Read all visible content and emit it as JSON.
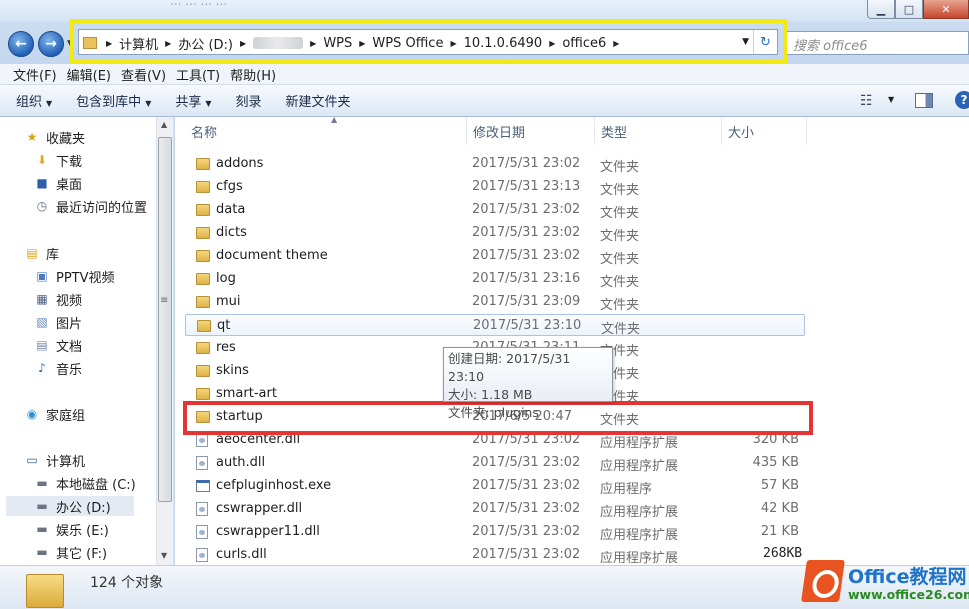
{
  "window": {
    "faded_title": "... ... ... ...",
    "minimize_glyph": "▁",
    "maximize_glyph": "□",
    "close_glyph": "✕"
  },
  "nav": {
    "back_glyph": "←",
    "forward_glyph": "→",
    "dropdown_glyph": "▼"
  },
  "address": {
    "crumbs": [
      "计算机",
      "办公 (D:)",
      "",
      "WPS",
      "WPS Office",
      "10.1.0.6490",
      "office6"
    ],
    "separator": "▶",
    "dropdown_glyph": "▼",
    "refresh_glyph": "↻"
  },
  "search": {
    "placeholder": "搜索 office6"
  },
  "menubar": [
    "文件(F)",
    "编辑(E)",
    "查看(V)",
    "工具(T)",
    "帮助(H)"
  ],
  "commands": [
    {
      "label": "组织",
      "dropdown": true
    },
    {
      "label": "包含到库中",
      "dropdown": true
    },
    {
      "label": "共享",
      "dropdown": true
    },
    {
      "label": "刻录",
      "dropdown": false
    },
    {
      "label": "新建文件夹",
      "dropdown": false
    }
  ],
  "toolbar_icons": {
    "view": "☷",
    "view_dd": "▼",
    "help": "?"
  },
  "navpane": {
    "favorites": {
      "label": "收藏夹",
      "items": [
        "下载",
        "桌面",
        "最近访问的位置"
      ]
    },
    "libraries": {
      "label": "库",
      "items": [
        "PPTV视频",
        "视频",
        "图片",
        "文档",
        "音乐"
      ]
    },
    "homegroup": "家庭组",
    "computer": {
      "label": "计算机",
      "items": [
        "本地磁盘 (C:)",
        "办公 (D:)",
        "娱乐 (E:)",
        "其它 (F:)"
      ]
    },
    "selected": "办公 (D:)",
    "scroll_up": "▲",
    "scroll_down": "▼",
    "scroll_grip": "≡"
  },
  "columns": {
    "name": "名称",
    "date": "修改日期",
    "type": "类型",
    "size": "大小",
    "sort_caret": "▲"
  },
  "files": [
    {
      "name": "addons",
      "date": "2017/5/31 23:02",
      "type": "文件夹",
      "size": "",
      "kind": "folder"
    },
    {
      "name": "cfgs",
      "date": "2017/5/31 23:13",
      "type": "文件夹",
      "size": "",
      "kind": "folder"
    },
    {
      "name": "data",
      "date": "2017/5/31 23:02",
      "type": "文件夹",
      "size": "",
      "kind": "folder"
    },
    {
      "name": "dicts",
      "date": "2017/5/31 23:02",
      "type": "文件夹",
      "size": "",
      "kind": "folder"
    },
    {
      "name": "document theme",
      "date": "2017/5/31 23:02",
      "type": "文件夹",
      "size": "",
      "kind": "folder"
    },
    {
      "name": "log",
      "date": "2017/5/31 23:16",
      "type": "文件夹",
      "size": "",
      "kind": "folder"
    },
    {
      "name": "mui",
      "date": "2017/5/31 23:09",
      "type": "文件夹",
      "size": "",
      "kind": "folder"
    },
    {
      "name": "qt",
      "date": "2017/5/31 23:10",
      "type": "文件夹",
      "size": "",
      "kind": "folder"
    },
    {
      "name": "res",
      "date": "2017/5/31 23:11",
      "type": "文件夹",
      "size": "",
      "kind": "folder"
    },
    {
      "name": "skins",
      "date": "2017/5/31 23:12",
      "type": "文件夹",
      "size": "",
      "kind": "folder"
    },
    {
      "name": "smart-art",
      "date": "2017/5/31 23:12",
      "type": "文件夹",
      "size": "",
      "kind": "folder"
    },
    {
      "name": "startup",
      "date": "2017/6/5 20:47",
      "type": "文件夹",
      "size": "",
      "kind": "folder"
    },
    {
      "name": "aeocenter.dll",
      "date": "2017/5/31 23:02",
      "type": "应用程序扩展",
      "size": "320 KB",
      "kind": "dll"
    },
    {
      "name": "auth.dll",
      "date": "2017/5/31 23:02",
      "type": "应用程序扩展",
      "size": "435 KB",
      "kind": "dll"
    },
    {
      "name": "cefpluginhost.exe",
      "date": "2017/5/31 23:02",
      "type": "应用程序",
      "size": "57 KB",
      "kind": "exe"
    },
    {
      "name": "cswrapper.dll",
      "date": "2017/5/31 23:02",
      "type": "应用程序扩展",
      "size": "42 KB",
      "kind": "dll"
    },
    {
      "name": "cswrapper11.dll",
      "date": "2017/5/31 23:02",
      "type": "应用程序扩展",
      "size": "21 KB",
      "kind": "dll"
    },
    {
      "name": "curls.dll",
      "date": "2017/5/31 23:02",
      "type": "应用程序扩展",
      "size": "",
      "kind": "dll"
    }
  ],
  "hover_row": "qt",
  "highlight_row": "startup",
  "tooltip": {
    "created": "创建日期: 2017/5/31 23:10",
    "size": "大小: 1.18 MB",
    "folders": "文件夹: plugins"
  },
  "stray_text": "268KB",
  "status": {
    "count": "124 个对象"
  },
  "watermark": {
    "title": "Office教程网",
    "url": "www.office26.com"
  },
  "colors": {
    "highlight_yellow": "#f2ea0f",
    "highlight_red": "#e53434",
    "accent": "#2462b7"
  }
}
